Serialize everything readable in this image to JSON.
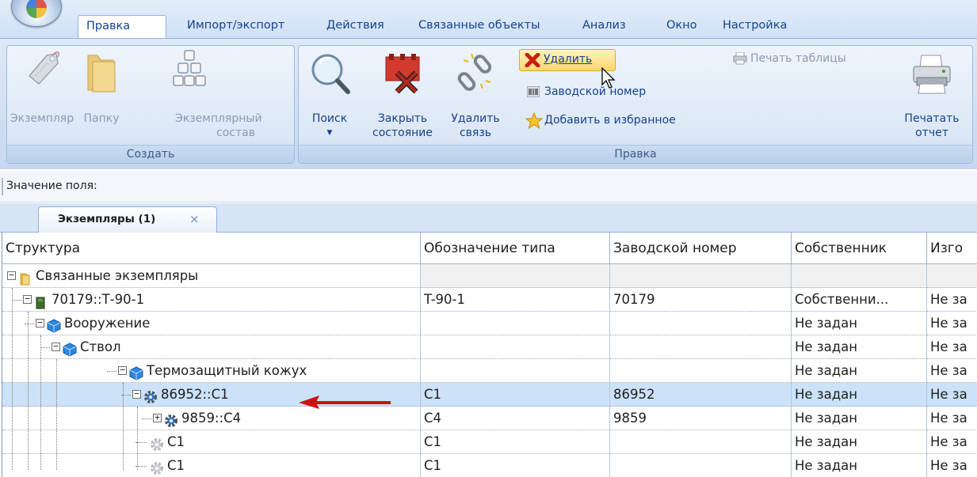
{
  "ribbon_tabs": [
    "Правка",
    "Импорт/экспорт",
    "Действия",
    "Связанные объекты",
    "Анализ",
    "Окно",
    "Настройка"
  ],
  "groups": {
    "create": {
      "label": "Создать",
      "instance": "Экземпляр",
      "folder": "Папку",
      "composition_line1": "Экземплярный",
      "composition_line2": "состав"
    },
    "edit": {
      "label": "Правка",
      "search": "Поиск",
      "close_state_line1": "Закрыть",
      "close_state_line2": "состояние",
      "delete_link_line1": "Удалить",
      "delete_link_line2": "связь",
      "delete": "Удалить",
      "serial_number": "Заводской номер",
      "add_favorites": "Добавить в избранное",
      "print_table": "Печать таблицы",
      "print_report_line1": "Печатать",
      "print_report_line2": "отчет"
    }
  },
  "field_value_label": "Значение поля:",
  "doc_tab": {
    "title": "Экземпляры (1)",
    "close": "×"
  },
  "grid": {
    "columns": [
      "Структура",
      "Обозначение типа",
      "Заводской номер",
      "Собственник",
      "Изго"
    ],
    "rows": [
      {
        "name": "Связанные экземпляры",
        "type": "",
        "serial": "",
        "owner": "",
        "maker": ""
      },
      {
        "name": "70179::Т-90-1",
        "type": "T-90-1",
        "serial": "70179",
        "owner": "Собственни...",
        "maker": "Не за"
      },
      {
        "name": "Вооружение",
        "type": "",
        "serial": "",
        "owner": "Не задан",
        "maker": "Не за"
      },
      {
        "name": "Ствол",
        "type": "",
        "serial": "",
        "owner": "Не задан",
        "maker": "Не за"
      },
      {
        "name": "Термозащитный кожух",
        "type": "",
        "serial": "",
        "owner": "Не задан",
        "maker": "Не за"
      },
      {
        "name": "86952::C1",
        "type": "C1",
        "serial": "86952",
        "owner": "Не задан",
        "maker": "Не за"
      },
      {
        "name": "9859::C4",
        "type": "C4",
        "serial": "9859",
        "owner": "Не задан",
        "maker": "Не за"
      },
      {
        "name": "C1",
        "type": "C1",
        "serial": "",
        "owner": "Не задан",
        "maker": "Не за"
      },
      {
        "name": "C1",
        "type": "C1",
        "serial": "",
        "owner": "Не задан",
        "maker": "Не за"
      }
    ]
  },
  "colors": {
    "accent": "#15428b",
    "selection": "#cce2f8",
    "arrow": "#c81414"
  }
}
